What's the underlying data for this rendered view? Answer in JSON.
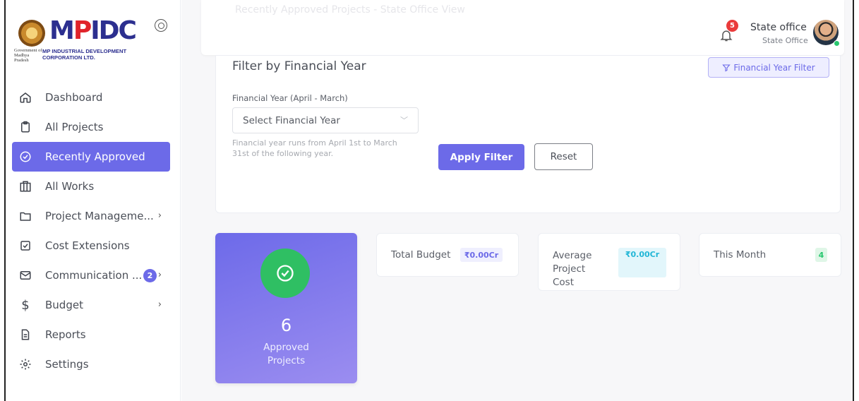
{
  "sidebar": {
    "logo": {
      "wordmark_prefix": "M",
      "wordmark_accent": "P",
      "wordmark_suffix": "IDC",
      "gov_text": "Government of Madhya Pradesh",
      "corp_line1": "MP INDUSTRIAL DEVELOPMENT",
      "corp_line2": "CORPORATION LTD."
    },
    "items": [
      {
        "label": "Dashboard",
        "icon": "home-icon"
      },
      {
        "label": "All Projects",
        "icon": "clipboard-icon"
      },
      {
        "label": "Recently Approved",
        "icon": "check-circle-icon",
        "active": true
      },
      {
        "label": "All Works",
        "icon": "building-icon"
      },
      {
        "label": "Project Manageme...",
        "icon": "folder-icon",
        "chevron": true
      },
      {
        "label": "Cost Extensions",
        "icon": "checkbox-icon"
      },
      {
        "label": "Communication ...",
        "icon": "mail-icon",
        "badge": "2",
        "chevron": true
      },
      {
        "label": "Budget",
        "icon": "dollar-icon",
        "chevron": true
      },
      {
        "label": "Reports",
        "icon": "document-icon"
      },
      {
        "label": "Settings",
        "icon": "gear-icon"
      }
    ]
  },
  "header": {
    "ghost_title": "Recently Approved Projects - State Office View",
    "notifications_count": "5",
    "user_name": "State office",
    "user_role": "State Office"
  },
  "filter": {
    "title": "Filter by Financial Year",
    "toggle_label": "Financial Year Filter",
    "field_label": "Financial Year (April - March)",
    "select_placeholder": "Select Financial Year",
    "help_text": "Financial year runs from April 1st to March 31st of the following year.",
    "apply_label": "Apply Filter",
    "reset_label": "Reset"
  },
  "stats": {
    "approved_count": "6",
    "approved_label": "Approved Projects",
    "total_budget_label": "Total Budget",
    "total_budget_value": "₹0.00Cr",
    "avg_cost_label": "Average Project Cost",
    "avg_cost_value": "₹0.00Cr",
    "this_month_label": "This Month",
    "this_month_value": "4"
  },
  "colors": {
    "accent": "#6c6ae8",
    "success": "#2fbf63",
    "danger": "#ea3b3b",
    "info": "#22b6d6"
  }
}
